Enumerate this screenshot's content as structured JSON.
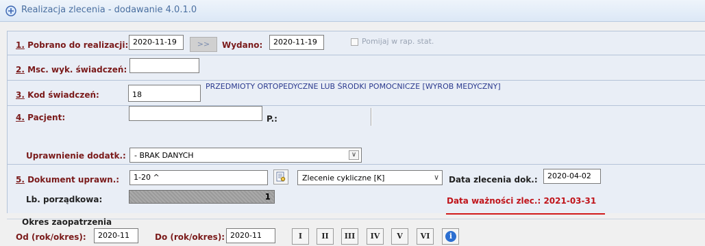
{
  "window": {
    "title": "Realizacja zlecenia - dodawanie 4.0.1.0"
  },
  "row1": {
    "num": "1.",
    "label": " Pobrano do realizacji:",
    "pobrano_value": "2020-11-19",
    "transfer_label": ">>",
    "wydano_label": "Wydano:",
    "wydano_value": "2020-11-19",
    "pomijaj_label": "Pomijaj w rap. stat."
  },
  "row2": {
    "num": "2.",
    "label": " Msc. wyk. świadczeń:",
    "value": ""
  },
  "row3": {
    "num": "3.",
    "label": " Kod świadczeń:",
    "value": "18",
    "description": "PRZEDMIOTY ORTOPEDYCZNE LUB ŚRODKI POMOCNICZE [WYROB MEDYCZNY]"
  },
  "row4": {
    "num": "4.",
    "label": " Pacjent:",
    "value": "",
    "p_label": "P.:",
    "uprawnienie_label": "Uprawnienie dodatk.:",
    "uprawnienie_value": "- BRAK DANYCH"
  },
  "row5": {
    "num": "5.",
    "label": " Dokument uprawn.:",
    "dokument_value": "1-20 ^",
    "typ_value": "Zlecenie cykliczne [K]",
    "data_zlecenia_label": "Data zlecenia dok.:",
    "data_zlecenia_value": "2020-04-02",
    "lb_label": "Lb. porządkowa:",
    "lb_value": "1",
    "waznosc_label": "Data ważności zlec.: 2021-03-31"
  },
  "okres": {
    "heading": "Okres zaopatrzenia",
    "od_label": "Od (rok/okres):",
    "od_value": "2020-11",
    "do_label": "Do (rok/okres):",
    "do_value": "2020-11",
    "periods": [
      "I",
      "II",
      "III",
      "IV",
      "V",
      "VI"
    ],
    "info_glyph": "i"
  },
  "colors": {
    "label": "#7a1a1a",
    "alert": "#c0141a",
    "accent_blue": "#2c6fd1"
  }
}
